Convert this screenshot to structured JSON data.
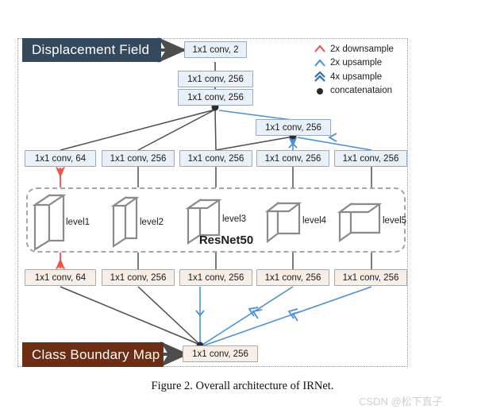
{
  "figure": {
    "caption": "Figure 2.  Overall architecture of IRNet.",
    "watermark": "CSDN @松下直子"
  },
  "outputs": {
    "displacement_field": "Displacement Field",
    "class_boundary_map": "Class Boundary Map"
  },
  "backbone": {
    "title": "ResNet50",
    "levels": [
      {
        "name": "level1"
      },
      {
        "name": "level2"
      },
      {
        "name": "level3"
      },
      {
        "name": "level4"
      },
      {
        "name": "level5"
      }
    ]
  },
  "displacement_branch": {
    "head": [
      {
        "label": "1x1 conv, 2"
      },
      {
        "label": "1x1 conv, 256"
      },
      {
        "label": "1x1 conv, 256"
      }
    ],
    "mid_concat": {
      "label": "1x1 conv, 256"
    },
    "level_convs": [
      {
        "label": "1x1 conv, 64"
      },
      {
        "label": "1x1 conv, 256"
      },
      {
        "label": "1x1 conv, 256"
      },
      {
        "label": "1x1 conv, 256"
      },
      {
        "label": "1x1 conv, 256"
      }
    ]
  },
  "boundary_branch": {
    "level_convs": [
      {
        "label": "1x1 conv, 64"
      },
      {
        "label": "1x1 conv, 256"
      },
      {
        "label": "1x1 conv, 256"
      },
      {
        "label": "1x1 conv, 256"
      },
      {
        "label": "1x1 conv, 256"
      }
    ],
    "head": {
      "label": "1x1 conv, 256"
    }
  },
  "legend": {
    "items": [
      {
        "icon": "chevron-up-red-icon",
        "label": "2x downsample"
      },
      {
        "icon": "chevron-up-blue-icon",
        "label": "2x upsample"
      },
      {
        "icon": "double-chevron-up-blue-icon",
        "label": "4x upsample"
      },
      {
        "icon": "filled-circle-icon",
        "label": "concatenataion"
      }
    ]
  },
  "colors": {
    "downsample": "#f4504a",
    "upsample": "#4a90d9",
    "plain_edge": "#4d4d4d",
    "conv_blue_fill": "#eaf0f7",
    "conv_cream_fill": "#f7eee8",
    "displacement_box": "#34495e",
    "boundary_box": "#6b2d13",
    "backbone_outline": "#808080"
  }
}
